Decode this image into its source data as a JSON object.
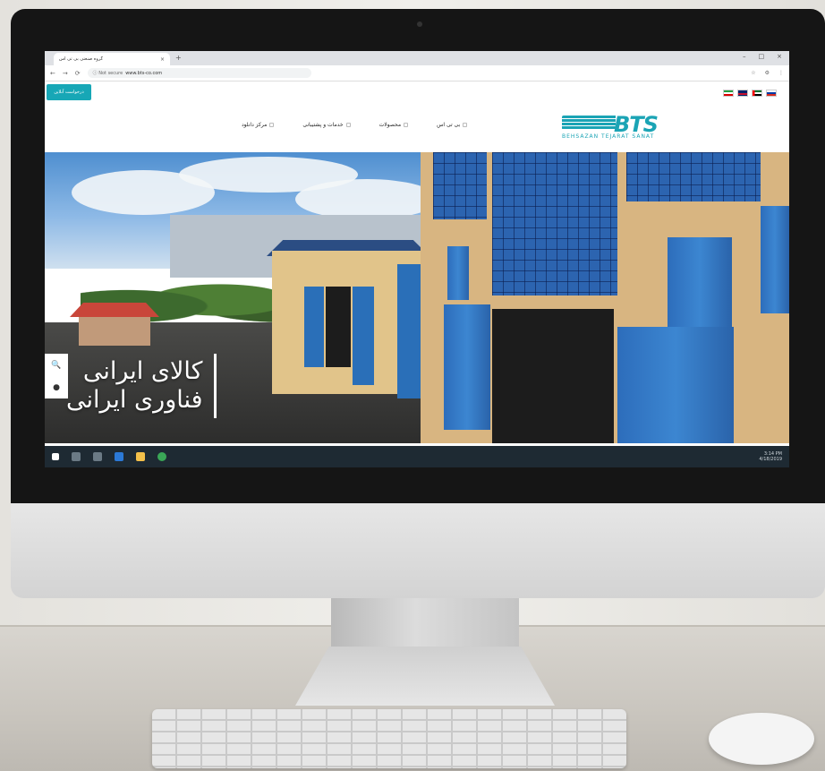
{
  "browser": {
    "tab_title": "گروه صنعتی بی تی اس",
    "tab_close": "×",
    "new_tab": "+",
    "window_controls": [
      "–",
      "□",
      "×"
    ],
    "nav": [
      "←",
      "→",
      "⟳"
    ],
    "address_info": "ⓘ Not secure",
    "address_url": "www.bts-co.com",
    "toolbar_icons": [
      "☆",
      "⚙",
      "⋮"
    ]
  },
  "site": {
    "cta_label": "درخواست آنلاین",
    "flags": [
      "flag-ir-icon",
      "flag-uk-icon",
      "flag-ae-icon",
      "flag-ru-icon"
    ],
    "menu": [
      {
        "label": "بی تی اس"
      },
      {
        "label": "محصولات"
      },
      {
        "label": "خدمات و پشتیبانی"
      },
      {
        "label": "مرکز دانلود"
      }
    ],
    "logo": {
      "text": "BTS",
      "sub": "BEHSAZAN TEJARAT SANAT"
    },
    "hero": {
      "line1": "کالای ایرانی",
      "line2": "فناوری ایرانی"
    },
    "side_tools": [
      "🔍",
      "●"
    ]
  },
  "taskbar": {
    "time": "3:14 PM",
    "date": "4/18/2019"
  },
  "colors": {
    "accent": "#1ba4b5",
    "bezel": "#151515",
    "building_blue": "#2c64b0"
  }
}
